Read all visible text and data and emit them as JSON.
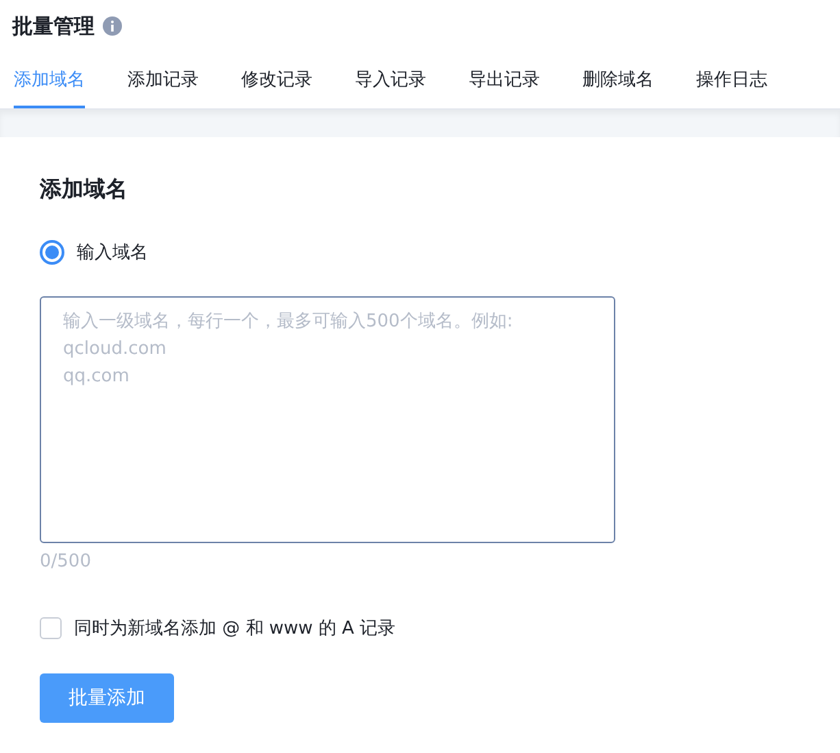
{
  "header": {
    "title": "批量管理"
  },
  "tabs": [
    {
      "label": "添加域名",
      "selected": true
    },
    {
      "label": "添加记录",
      "selected": false
    },
    {
      "label": "修改记录",
      "selected": false
    },
    {
      "label": "导入记录",
      "selected": false
    },
    {
      "label": "导出记录",
      "selected": false
    },
    {
      "label": "删除域名",
      "selected": false
    },
    {
      "label": "操作日志",
      "selected": false
    }
  ],
  "form": {
    "heading": "添加域名",
    "radio": {
      "label": "输入域名",
      "selected": true
    },
    "domains_field": {
      "placeholder": "输入一级域名，每行一个，最多可输入500个域名。例如:\nqcloud.com\nqq.com"
    },
    "counter": "0/500",
    "checkbox": {
      "label": "同时为新域名添加 @ 和 www 的 A 记录",
      "checked": false
    },
    "submit_button": "批量添加"
  }
}
